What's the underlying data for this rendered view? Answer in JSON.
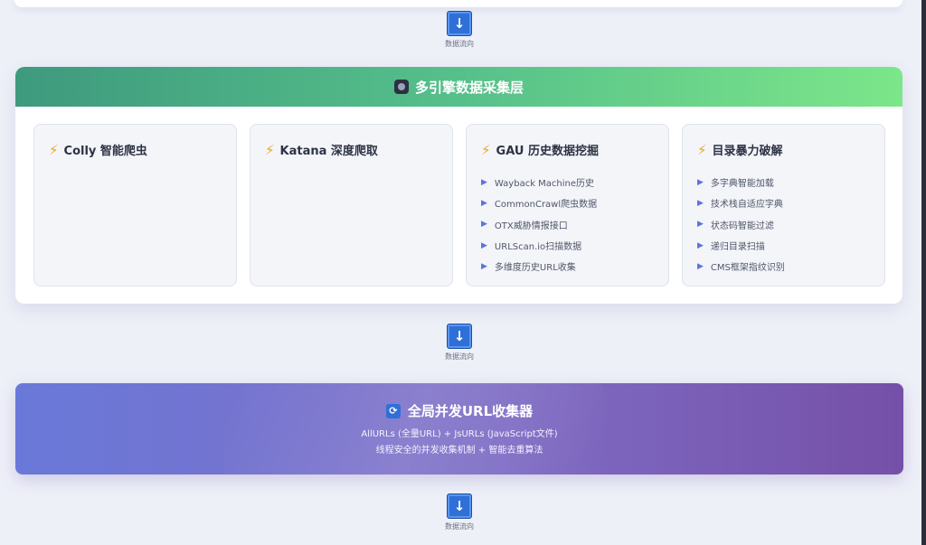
{
  "flow": {
    "label": "数据流向",
    "arrow": "↓"
  },
  "layer": {
    "icon": "gear-icon",
    "title": "多引擎数据采集层",
    "engines": [
      {
        "title": "Colly 智能爬虫",
        "items": []
      },
      {
        "title": "Katana 深度爬取",
        "items": []
      },
      {
        "title": "GAU 历史数据挖掘",
        "items": [
          "Wayback Machine历史",
          "CommonCrawl爬虫数据",
          "OTX威胁情报接口",
          "URLScan.io扫描数据",
          "多维度历史URL收集"
        ]
      },
      {
        "title": "目录暴力破解",
        "items": [
          "多字典智能加载",
          "技术栈自适应字典",
          "状态码智能过滤",
          "递归目录扫描",
          "CMS框架指纹识别"
        ]
      }
    ]
  },
  "collector": {
    "icon": "sync-icon",
    "title": "全局并发URL收集器",
    "line1": "AllURLs (全量URL) + JsURLs (JavaScript文件)",
    "line2": "线程安全的并发收集机制 + 智能去重算法"
  },
  "colors": {
    "header_start": "#3e9a7e",
    "header_end": "#7ce68a",
    "collector_start": "#6a79d9",
    "collector_end": "#7650a8",
    "arrow": "#2f6fd8"
  }
}
